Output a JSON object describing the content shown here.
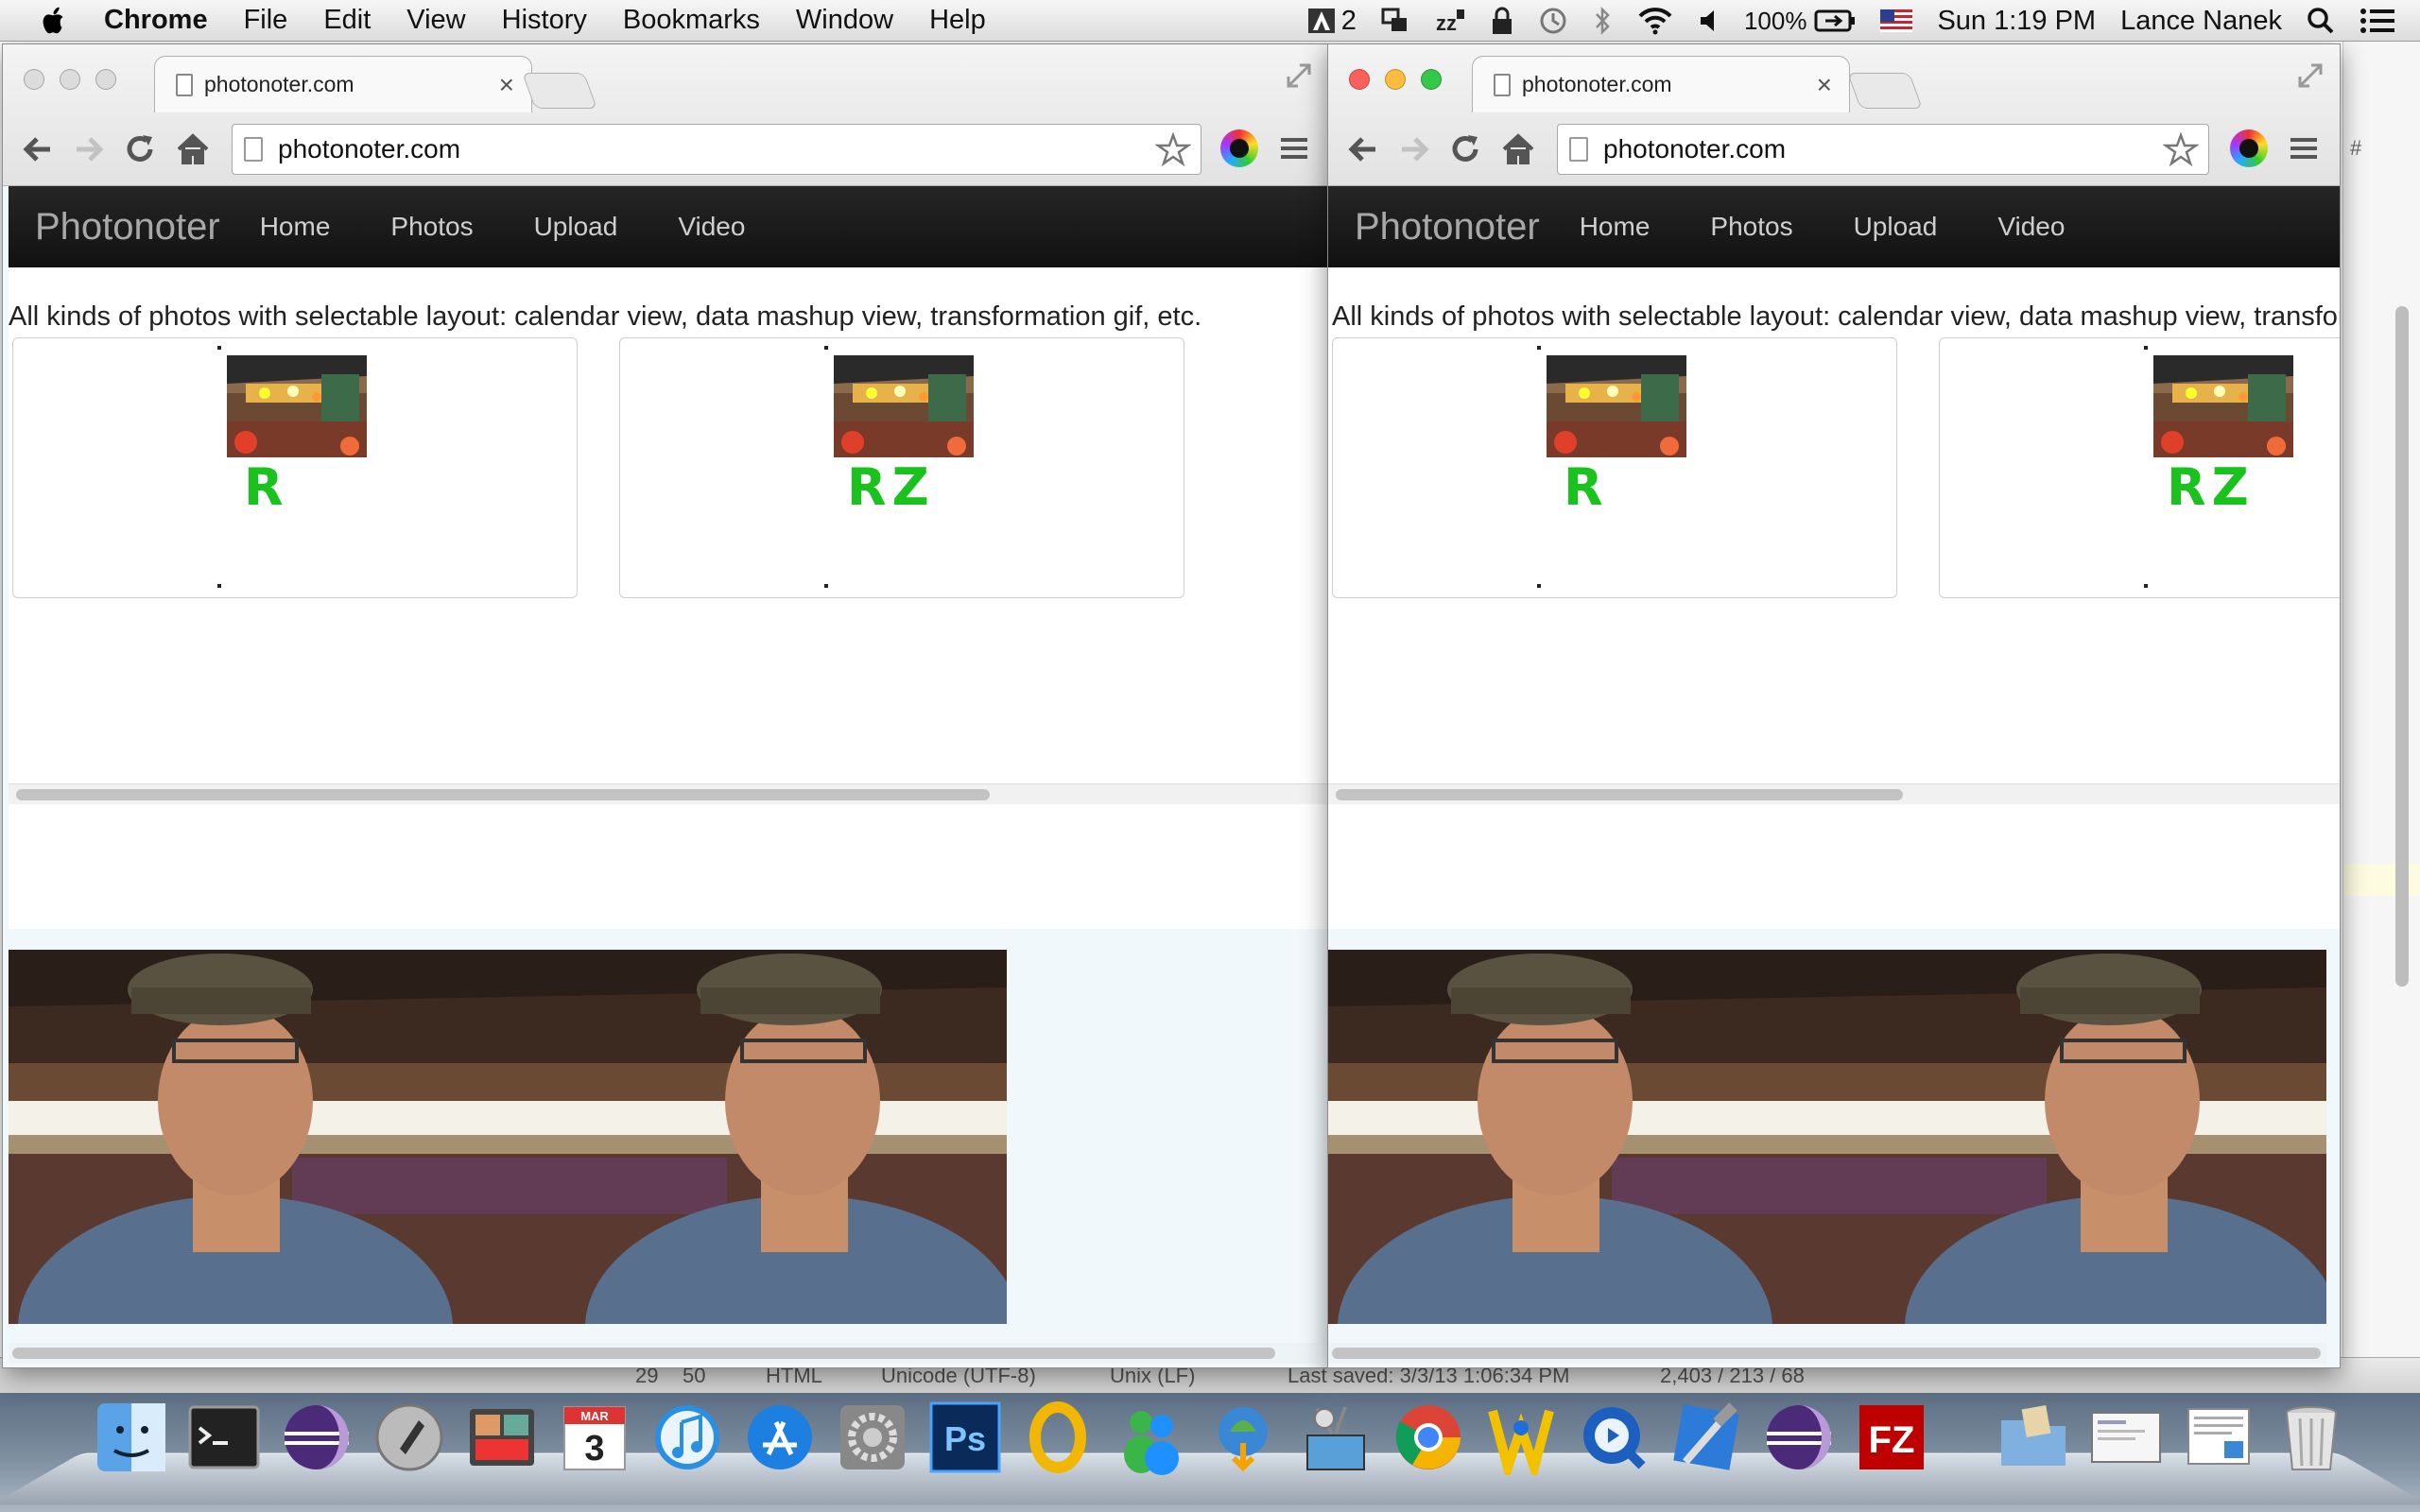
{
  "menubar": {
    "app_name": "Chrome",
    "menus": [
      "File",
      "Edit",
      "View",
      "History",
      "Bookmarks",
      "Window",
      "Help"
    ],
    "status": {
      "adobe_count": "2",
      "battery": "100%",
      "clock": "Sun 1:19 PM",
      "user": "Lance Nanek"
    }
  },
  "editor": {
    "status_line": "29",
    "status_col": "50",
    "syntax": "HTML",
    "encoding": "Unicode (UTF-8)",
    "line_endings": "Unix (LF)",
    "last_saved": "Last saved: 3/3/13 1:06:34 PM",
    "counts": "2,403 / 213 / 68",
    "gutter_marker": "#"
  },
  "windows": [
    {
      "tab_title": "photonoter.com",
      "url": "photonoter.com",
      "site": {
        "brand": "Photonoter",
        "nav": [
          "Home",
          "Photos",
          "Upload",
          "Video"
        ],
        "tagline": "All kinds of photos with selectable layout: calendar view, data mashup view, transformation gif, etc.",
        "cards": [
          {
            "drawn_text": "R"
          },
          {
            "drawn_text": "RZ"
          }
        ]
      }
    },
    {
      "tab_title": "photonoter.com",
      "url": "photonoter.com",
      "site": {
        "brand": "Photonoter",
        "nav": [
          "Home",
          "Photos",
          "Upload",
          "Video"
        ],
        "tagline": "All kinds of photos with selectable layout: calendar view, data mashup view, transfor",
        "cards": [
          {
            "drawn_text": "R"
          },
          {
            "drawn_text": "RZ"
          }
        ]
      }
    }
  ],
  "dock": {
    "calendar_month": "MAR",
    "calendar_day": "3",
    "photoshop_label": "Ps",
    "filezilla_label": "FZ",
    "items": [
      "finder-icon",
      "terminal-icon",
      "eclipse-icon",
      "launchpad-icon",
      "photo-booth-icon",
      "calendar-icon",
      "itunes-icon",
      "app-store-icon",
      "system-preferences-icon",
      "photoshop-icon",
      "opera-icon",
      "messenger-icon",
      "downloader-icon",
      "network-icon",
      "chrome-icon",
      "flow-icon",
      "quicktime-icon",
      "xcode-icon",
      "eclipse-icon",
      "filezilla-icon",
      "folder-icon",
      "screenshot-icon",
      "document-icon",
      "trash-icon"
    ]
  },
  "colors": {
    "nav_bg": "#1b1b1b",
    "page_bg": "#f1f8fb",
    "drawn_green": "#19c21c",
    "close_red": "#fc605c",
    "minimize_yellow": "#fdbc40",
    "zoom_green": "#34c84a"
  }
}
